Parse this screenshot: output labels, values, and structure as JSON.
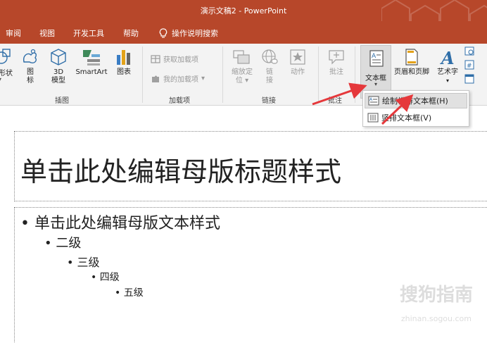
{
  "window": {
    "title": "演示文稿2  -  PowerPoint"
  },
  "tabs": [
    "审阅",
    "视图",
    "开发工具",
    "帮助"
  ],
  "tell_me": "操作说明搜索",
  "ribbon": {
    "illustrations": {
      "shapes": "形状",
      "icons_line1": "图",
      "icons_line2": "标",
      "model3d_line1": "3D",
      "model3d_line2": "模型",
      "smartart": "SmartArt",
      "chart": "图表",
      "group": "插图"
    },
    "addins": {
      "get": "获取加载项",
      "mine": "我的加载项",
      "group": "加载项"
    },
    "links": {
      "zoom_line1": "缩放定",
      "zoom_line2": "位",
      "link_line1": "链",
      "link_line2": "接",
      "action": "动作",
      "group": "链接"
    },
    "comments": {
      "comment": "批注",
      "group": "批注"
    },
    "text": {
      "textbox": "文本框",
      "header_footer": "页眉和页脚",
      "wordart": "艺术字"
    }
  },
  "dropdown": {
    "horizontal": "绘制横排文本框(H)",
    "vertical": "竖排文本框(V)"
  },
  "slide": {
    "title": "单击此处编辑母版标题样式",
    "level1": "单击此处编辑母版文本样式",
    "level2": "二级",
    "level3": "三级",
    "level4": "四级",
    "level5": "五级"
  },
  "watermark": {
    "text": "搜狗指南",
    "url": "zhinan.sogou.com"
  },
  "colors": {
    "accent": "#b7472a",
    "arrow": "#e5383b"
  }
}
